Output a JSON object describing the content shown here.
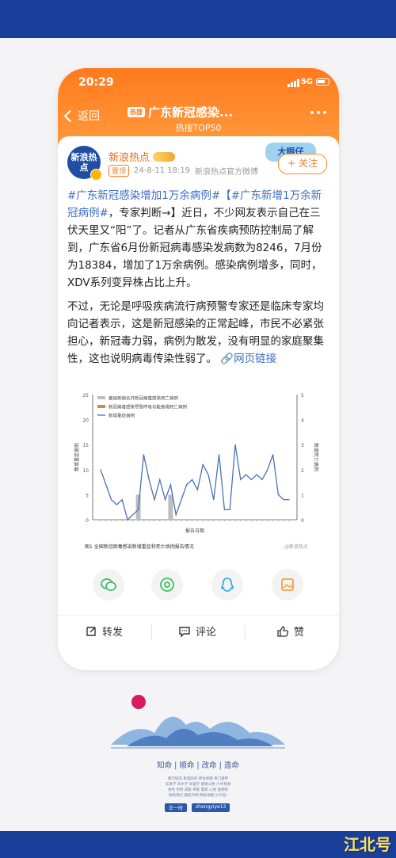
{
  "status_bar": {
    "time": "20:29",
    "network": "5G"
  },
  "nav": {
    "back_label": "返回",
    "title": "广东新冠感染...",
    "hot_badge": "热搜",
    "subtitle": "热搜TOP50"
  },
  "post": {
    "author": "新浪热点",
    "avatar_text": "新浪热点",
    "pinned_label": "置顶",
    "timestamp": "24-8-11 18:19",
    "source": "新浪热点官方微博",
    "follow_label": "+ 关注",
    "badge_text": "大眼仔",
    "paragraph1_link": "#广东新冠感染增加1万余病例#【#广东新增1万余新冠病例#",
    "paragraph1": "，专家判断→】近日，不少网友表示自己在三伏天里又“阳”了。记者从广东省疾病预防控制局了解到，广东省6月份新冠病毒感染发病数为8246，7月份为18384，增加了1万余病例。感染病例增多，同时，XDV系列变异株占比上升。",
    "paragraph2": "不过，无论是呼吸疾病流行病预警专家还是临床专家均向记者表示，这是新冠感染的正常起峰，市民不必紧张担心，新冠毒力弱，病例为散发，没有明显的家庭聚集性，这也说明病毒传染性弱了。",
    "web_link": "网页链接"
  },
  "chart_data": {
    "type": "line",
    "caption": "图1 全国新冠病毒感染新增重症和死亡病例报告情况",
    "watermark": "@新浪热点",
    "xlabel": "报告日期",
    "ylabel_left": "新增重症病例",
    "ylabel_right": "新增死亡病例",
    "ylim_left": [
      0,
      25
    ],
    "ylim_right": [
      0,
      5
    ],
    "yticks_left": [
      0,
      5,
      10,
      15,
      20,
      25
    ],
    "yticks_right": [
      0,
      1,
      2,
      3,
      4,
      5
    ],
    "legend_position": "top-left",
    "series": [
      {
        "name": "基础疾病合并新冠病毒感染死亡病例",
        "type": "bar",
        "color": "#bdbdbd",
        "axis": "right",
        "values": [
          0,
          0,
          0,
          0,
          0,
          0,
          0,
          1,
          0,
          0,
          0,
          0,
          0,
          1,
          0,
          0,
          0,
          0,
          0,
          0,
          0,
          0,
          0,
          0,
          0,
          0,
          0,
          0,
          0,
          0,
          0,
          0,
          0,
          0,
          0,
          0
        ]
      },
      {
        "name": "新冠病毒感染导致呼吸功能衰竭死亡病例",
        "type": "bar",
        "color": "#d08a45",
        "axis": "right",
        "values": [
          0,
          0,
          0,
          0,
          0,
          0,
          0,
          0,
          0,
          0,
          0,
          0,
          0,
          0,
          0,
          0,
          0,
          0,
          0,
          0,
          0,
          0,
          0,
          0,
          0,
          0,
          0,
          0,
          0,
          0,
          0,
          0,
          0,
          0,
          0,
          0
        ]
      },
      {
        "name": "新增重症病例",
        "type": "line",
        "color": "#4a72b8",
        "axis": "left",
        "values": [
          10,
          7,
          4,
          3,
          4,
          0,
          1,
          2,
          13,
          8,
          4,
          8,
          4,
          7,
          1,
          4,
          7,
          8,
          6,
          11,
          9,
          4,
          13,
          2,
          2,
          15,
          8,
          9,
          8,
          9,
          8,
          10,
          13,
          5,
          4,
          4
        ]
      }
    ]
  },
  "share_icons": [
    "wechat-icon",
    "moments-icon",
    "qq-icon",
    "gallery-icon"
  ],
  "actions": {
    "repost": "转发",
    "comment": "评论",
    "like": "赞"
  },
  "footer": {
    "nav": [
      "知命",
      "顺命",
      "改命",
      "造命"
    ],
    "small_lines": [
      "佛学研究 易理研究 养生保健 奇门遁甲",
      "玄易学 风水学 命理学 紫微斗数 六爻预测",
      "易经 周易 道家 佛家 儒家 心经 金刚经",
      "联系我们 版权声明 网站地图 (ICP证)"
    ],
    "buttons": [
      "正一时",
      "zhengyiye13"
    ]
  },
  "watermark_corner": "江北号",
  "colors": {
    "accent": "#ff7a1d",
    "link": "#3b6cc5",
    "band": "#193f9b",
    "series_line": "#4a72b8"
  }
}
